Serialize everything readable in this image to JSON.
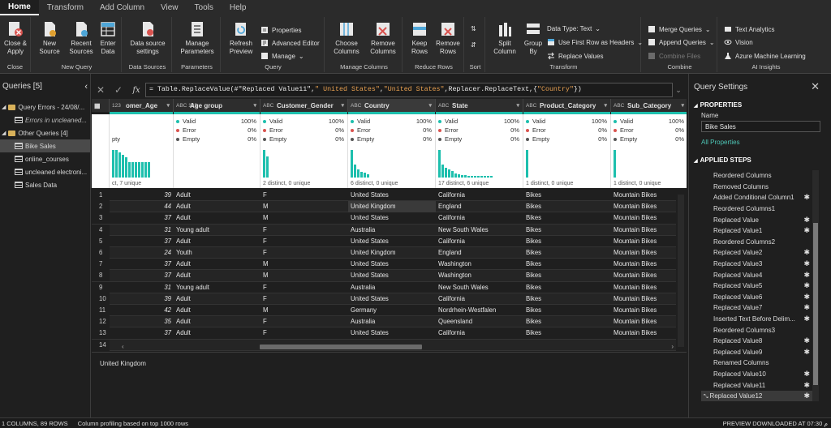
{
  "menu": [
    "Home",
    "Transform",
    "Add Column",
    "View",
    "Tools",
    "Help"
  ],
  "ribbon": {
    "close_apply": "Close &\nApply",
    "new_source": "New\nSource",
    "recent_sources": "Recent\nSources",
    "enter_data": "Enter\nData",
    "data_source_settings": "Data source\nsettings",
    "manage_parameters": "Manage\nParameters",
    "refresh_preview": "Refresh\nPreview",
    "properties": "Properties",
    "advanced_editor": "Advanced Editor",
    "manage": "Manage",
    "choose_columns": "Choose\nColumns",
    "remove_columns": "Remove\nColumns",
    "keep_rows": "Keep\nRows",
    "remove_rows": "Remove\nRows",
    "split_column": "Split\nColumn",
    "group_by": "Group\nBy",
    "data_type": "Data Type: Text",
    "use_first_row": "Use First Row as Headers",
    "replace_values": "Replace Values",
    "merge_queries": "Merge Queries",
    "append_queries": "Append Queries",
    "combine_files": "Combine Files",
    "text_analytics": "Text Analytics",
    "vision": "Vision",
    "azure_ml": "Azure Machine Learning",
    "groups": {
      "close": "Close",
      "new_query": "New Query",
      "data_sources": "Data Sources",
      "parameters": "Parameters",
      "query": "Query",
      "manage_columns": "Manage Columns",
      "reduce_rows": "Reduce Rows",
      "sort": "Sort",
      "transform": "Transform",
      "combine": "Combine",
      "ai_insights": "AI Insights"
    }
  },
  "queries": {
    "title": "Queries [5]",
    "items": [
      {
        "label": "Query Errors - 24/08/...",
        "kind": "folder"
      },
      {
        "label": "Errors in uncleaned...",
        "kind": "error"
      },
      {
        "label": "Other Queries [4]",
        "kind": "folder"
      },
      {
        "label": "Bike Sales",
        "kind": "table",
        "selected": true
      },
      {
        "label": "online_courses",
        "kind": "table"
      },
      {
        "label": "uncleaned electroni...",
        "kind": "table"
      },
      {
        "label": "Sales Data",
        "kind": "table"
      }
    ]
  },
  "formula": {
    "prefix": "= Table.ReplaceValue(#\"Replaced Value11\",",
    "s1": "\" United States\"",
    "comma": ",",
    "s2": "\"United States\"",
    "mid": ",Replacer.ReplaceText,{",
    "s3": "\"Country\"",
    "end": "})"
  },
  "columns": [
    {
      "name": "omer_Age",
      "type": "123",
      "valid": "",
      "error": "",
      "empty": "pty",
      "distinct": "ct, 7 unique",
      "hist": [
        22,
        22,
        20,
        18,
        16,
        12,
        12,
        12,
        12,
        12,
        12,
        12
      ]
    },
    {
      "name": "Age group",
      "type": "ABC\n123",
      "valid": "100%",
      "error": "0%",
      "empty": "0%",
      "distinct": "",
      "hist": []
    },
    {
      "name": "Customer_Gender",
      "type": "ABC",
      "valid": "100%",
      "error": "0%",
      "empty": "0%",
      "distinct": "2 distinct, 0 unique",
      "hist": [
        34,
        26
      ]
    },
    {
      "name": "Country",
      "type": "ABC",
      "valid": "100%",
      "error": "0%",
      "empty": "0%",
      "distinct": "6 distinct, 0 unique",
      "hist": [
        34,
        16,
        10,
        7,
        6,
        4
      ]
    },
    {
      "name": "State",
      "type": "ABC",
      "valid": "100%",
      "error": "0%",
      "empty": "0%",
      "distinct": "17 distinct, 6 unique",
      "hist": [
        34,
        16,
        12,
        10,
        8,
        5,
        4,
        3,
        3,
        2,
        2,
        2,
        2,
        2,
        2,
        2,
        2
      ]
    },
    {
      "name": "Product_Category",
      "type": "ABC",
      "valid": "100%",
      "error": "0%",
      "empty": "0%",
      "distinct": "1 distinct, 0 unique",
      "hist": [
        34
      ]
    },
    {
      "name": "Sub_Category",
      "type": "ABC",
      "valid": "100%",
      "error": "0%",
      "empty": "0%",
      "distinct": "1 distinct, 0 unique",
      "hist": [
        34
      ]
    }
  ],
  "profile_labels": {
    "valid": "Valid",
    "error": "Error",
    "empty": "Empty"
  },
  "rows": [
    [
      "1",
      "39",
      "Adult",
      "F",
      "United States",
      "California",
      "Bikes",
      "Mountain Bikes"
    ],
    [
      "2",
      "44",
      "Adult",
      "M",
      "United Kingdom",
      "England",
      "Bikes",
      "Mountain Bikes"
    ],
    [
      "3",
      "37",
      "Adult",
      "M",
      "United States",
      "California",
      "Bikes",
      "Mountain Bikes"
    ],
    [
      "4",
      "31",
      "Young adult",
      "F",
      "Australia",
      "New South Wales",
      "Bikes",
      "Mountain Bikes"
    ],
    [
      "5",
      "37",
      "Adult",
      "F",
      "United States",
      "California",
      "Bikes",
      "Mountain Bikes"
    ],
    [
      "6",
      "24",
      "Youth",
      "F",
      "United Kingdom",
      "England",
      "Bikes",
      "Mountain Bikes"
    ],
    [
      "7",
      "37",
      "Adult",
      "M",
      "United States",
      "Washington",
      "Bikes",
      "Mountain Bikes"
    ],
    [
      "8",
      "37",
      "Adult",
      "M",
      "United States",
      "Washington",
      "Bikes",
      "Mountain Bikes"
    ],
    [
      "9",
      "31",
      "Young adult",
      "F",
      "Australia",
      "New South Wales",
      "Bikes",
      "Mountain Bikes"
    ],
    [
      "10",
      "39",
      "Adult",
      "F",
      "United States",
      "California",
      "Bikes",
      "Mountain Bikes"
    ],
    [
      "11",
      "42",
      "Adult",
      "M",
      "Germany",
      "Nordrhein-Westfalen",
      "Bikes",
      "Mountain Bikes"
    ],
    [
      "12",
      "35",
      "Adult",
      "F",
      "Australia",
      "Queensland",
      "Bikes",
      "Mountain Bikes"
    ],
    [
      "13",
      "37",
      "Adult",
      "F",
      "United States",
      "California",
      "Bikes",
      "Mountain Bikes"
    ],
    [
      "14",
      "",
      "",
      "",
      "",
      "",
      "",
      ""
    ]
  ],
  "detail_value": "United Kingdom",
  "settings": {
    "title": "Query Settings",
    "properties": "PROPERTIES",
    "name_label": "Name",
    "name_value": "Bike Sales",
    "all_properties": "All Properties",
    "applied_steps": "APPLIED STEPS",
    "steps": [
      {
        "label": "Reordered Columns",
        "gear": false
      },
      {
        "label": "Removed Columns",
        "gear": false
      },
      {
        "label": "Added Conditional Column1",
        "gear": true
      },
      {
        "label": "Reordered Columns1",
        "gear": false
      },
      {
        "label": "Replaced Value",
        "gear": true
      },
      {
        "label": "Replaced Value1",
        "gear": true
      },
      {
        "label": "Reordered Columns2",
        "gear": false
      },
      {
        "label": "Replaced Value2",
        "gear": true
      },
      {
        "label": "Replaced Value3",
        "gear": true
      },
      {
        "label": "Replaced Value4",
        "gear": true
      },
      {
        "label": "Replaced Value5",
        "gear": true
      },
      {
        "label": "Replaced Value6",
        "gear": true
      },
      {
        "label": "Replaced Value7",
        "gear": true
      },
      {
        "label": "Inserted Text Before Delim...",
        "gear": true
      },
      {
        "label": "Reordered Columns3",
        "gear": false
      },
      {
        "label": "Replaced Value8",
        "gear": true
      },
      {
        "label": "Replaced Value9",
        "gear": true
      },
      {
        "label": "Renamed Columns",
        "gear": false
      },
      {
        "label": "Replaced Value10",
        "gear": true
      },
      {
        "label": "Replaced Value11",
        "gear": true
      },
      {
        "label": "Replaced Value12",
        "gear": true,
        "selected": true
      }
    ]
  },
  "status": {
    "left": "1 COLUMNS, 89 ROWS",
    "profiling": "Column profiling based on top 1000 rows",
    "right": "PREVIEW DOWNLOADED AT 07:30 م"
  },
  "colors": {
    "accent": "#1dbfad",
    "error": "#d9534f",
    "empty": "#555555"
  }
}
